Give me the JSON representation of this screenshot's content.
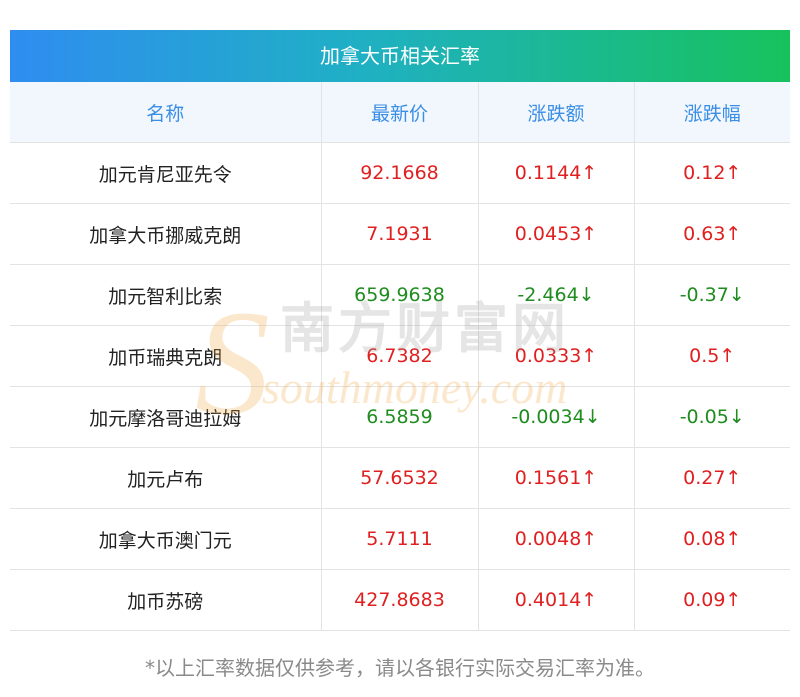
{
  "title": "加拿大币相关汇率",
  "headers": [
    "名称",
    "最新价",
    "涨跌额",
    "涨跌幅"
  ],
  "rows": [
    {
      "name": "加元肯尼亚先令",
      "price": "92.1668",
      "change": "0.1144↑",
      "pct": "0.12↑",
      "dir": "up"
    },
    {
      "name": "加拿大币挪威克朗",
      "price": "7.1931",
      "change": "0.0453↑",
      "pct": "0.63↑",
      "dir": "up"
    },
    {
      "name": "加元智利比索",
      "price": "659.9638",
      "change": "-2.464↓",
      "pct": "-0.37↓",
      "dir": "down"
    },
    {
      "name": "加币瑞典克朗",
      "price": "6.7382",
      "change": "0.0333↑",
      "pct": "0.5↑",
      "dir": "up"
    },
    {
      "name": "加元摩洛哥迪拉姆",
      "price": "6.5859",
      "change": "-0.0034↓",
      "pct": "-0.05↓",
      "dir": "down"
    },
    {
      "name": "加元卢布",
      "price": "57.6532",
      "change": "0.1561↑",
      "pct": "0.27↑",
      "dir": "up"
    },
    {
      "name": "加拿大币澳门元",
      "price": "5.7111",
      "change": "0.0048↑",
      "pct": "0.08↑",
      "dir": "up"
    },
    {
      "name": "加币苏磅",
      "price": "427.8683",
      "change": "0.4014↑",
      "pct": "0.09↑",
      "dir": "up"
    }
  ],
  "watermark": {
    "cn": "南方财富网",
    "en": "southmoney.com"
  },
  "note": "*以上汇率数据仅供参考，请以各银行实际交易汇率为准。",
  "colors": {
    "up": "#e02020",
    "down": "#1e8c1e",
    "header_text": "#3a8ee6"
  }
}
